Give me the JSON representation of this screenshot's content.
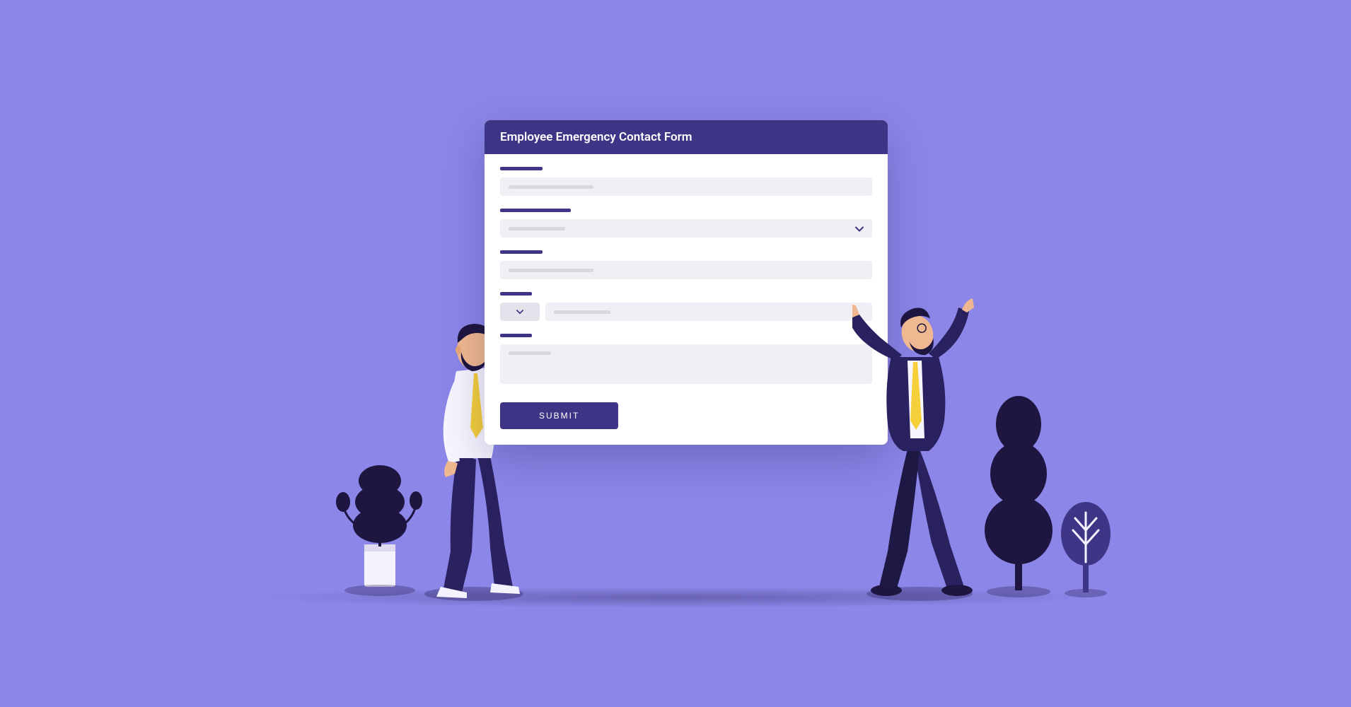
{
  "form": {
    "title": "Employee Emergency Contact Form",
    "submit_label": "SUBMIT"
  },
  "colors": {
    "background": "#8b86e8",
    "primary": "#3f3586",
    "accent": "#f5d03b",
    "dark": "#1e1640"
  }
}
